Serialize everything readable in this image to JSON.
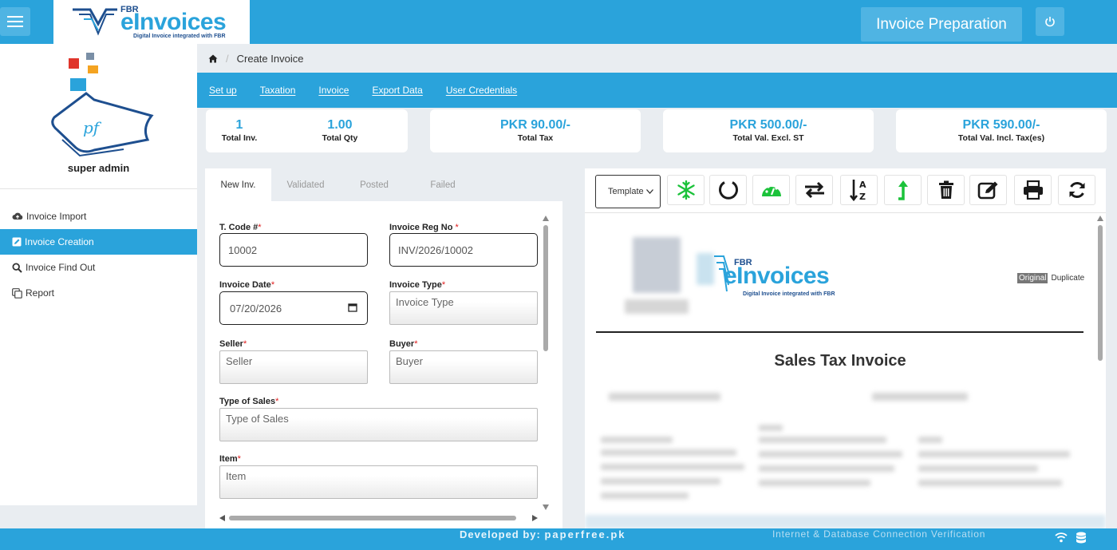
{
  "app": {
    "logo_prefix": "FBR",
    "logo_word": "eInvoices",
    "logo_tagline": "Digital Invoice integrated with FBR",
    "page_button": "Invoice Preparation",
    "accent_color": "#2aa3db"
  },
  "sidebar": {
    "user_name": "super admin",
    "items": [
      {
        "label": "Invoice Import",
        "icon": "cloud-upload-icon",
        "active": false
      },
      {
        "label": "Invoice Creation",
        "icon": "edit-icon",
        "active": true
      },
      {
        "label": "Invoice Find Out",
        "icon": "search-icon",
        "active": false
      },
      {
        "label": "Report",
        "icon": "copy-icon",
        "active": false
      }
    ]
  },
  "breadcrumb": {
    "current": "Create Invoice"
  },
  "subnav": [
    "Set up",
    "Taxation",
    "Invoice",
    "Export Data",
    "User Credentials"
  ],
  "stats": {
    "total_inv": {
      "value": "1",
      "label": "Total Inv."
    },
    "total_qty": {
      "value": "1.00",
      "label": "Total Qty"
    },
    "total_tax": {
      "value": "PKR 90.00/-",
      "label": "Total Tax"
    },
    "total_excl": {
      "value": "PKR 500.00/-",
      "label": "Total Val. Excl. ST"
    },
    "total_incl": {
      "value": "PKR 590.00/-",
      "label": "Total Val. Incl. Tax(es)"
    }
  },
  "form": {
    "tabs": [
      "New Inv.",
      "Validated",
      "Posted",
      "Failed"
    ],
    "t_code": {
      "label": "T. Code #",
      "value": "10002"
    },
    "invoice_reg_no": {
      "label": "Invoice Reg No",
      "value": "INV/2026/10002"
    },
    "invoice_date": {
      "label": "Invoice Date",
      "value": "07/20/2026"
    },
    "invoice_type": {
      "label": "Invoice Type",
      "placeholder": "Invoice Type"
    },
    "seller": {
      "label": "Seller",
      "placeholder": "Seller"
    },
    "buyer": {
      "label": "Buyer",
      "placeholder": "Buyer"
    },
    "type_of_sales": {
      "label": "Type of Sales",
      "placeholder": "Type of Sales"
    },
    "item": {
      "label": "Item",
      "placeholder": "Item"
    },
    "required_mark": "*"
  },
  "preview": {
    "template_label": "Template",
    "copy_original": "Original",
    "copy_duplicate": "Duplicate",
    "doc_title": "Sales Tax Invoice"
  },
  "footer": {
    "developed_by": "Developed by:",
    "developer": "paperfree.pk",
    "connection_text": "Internet & Database Connection Verification"
  }
}
